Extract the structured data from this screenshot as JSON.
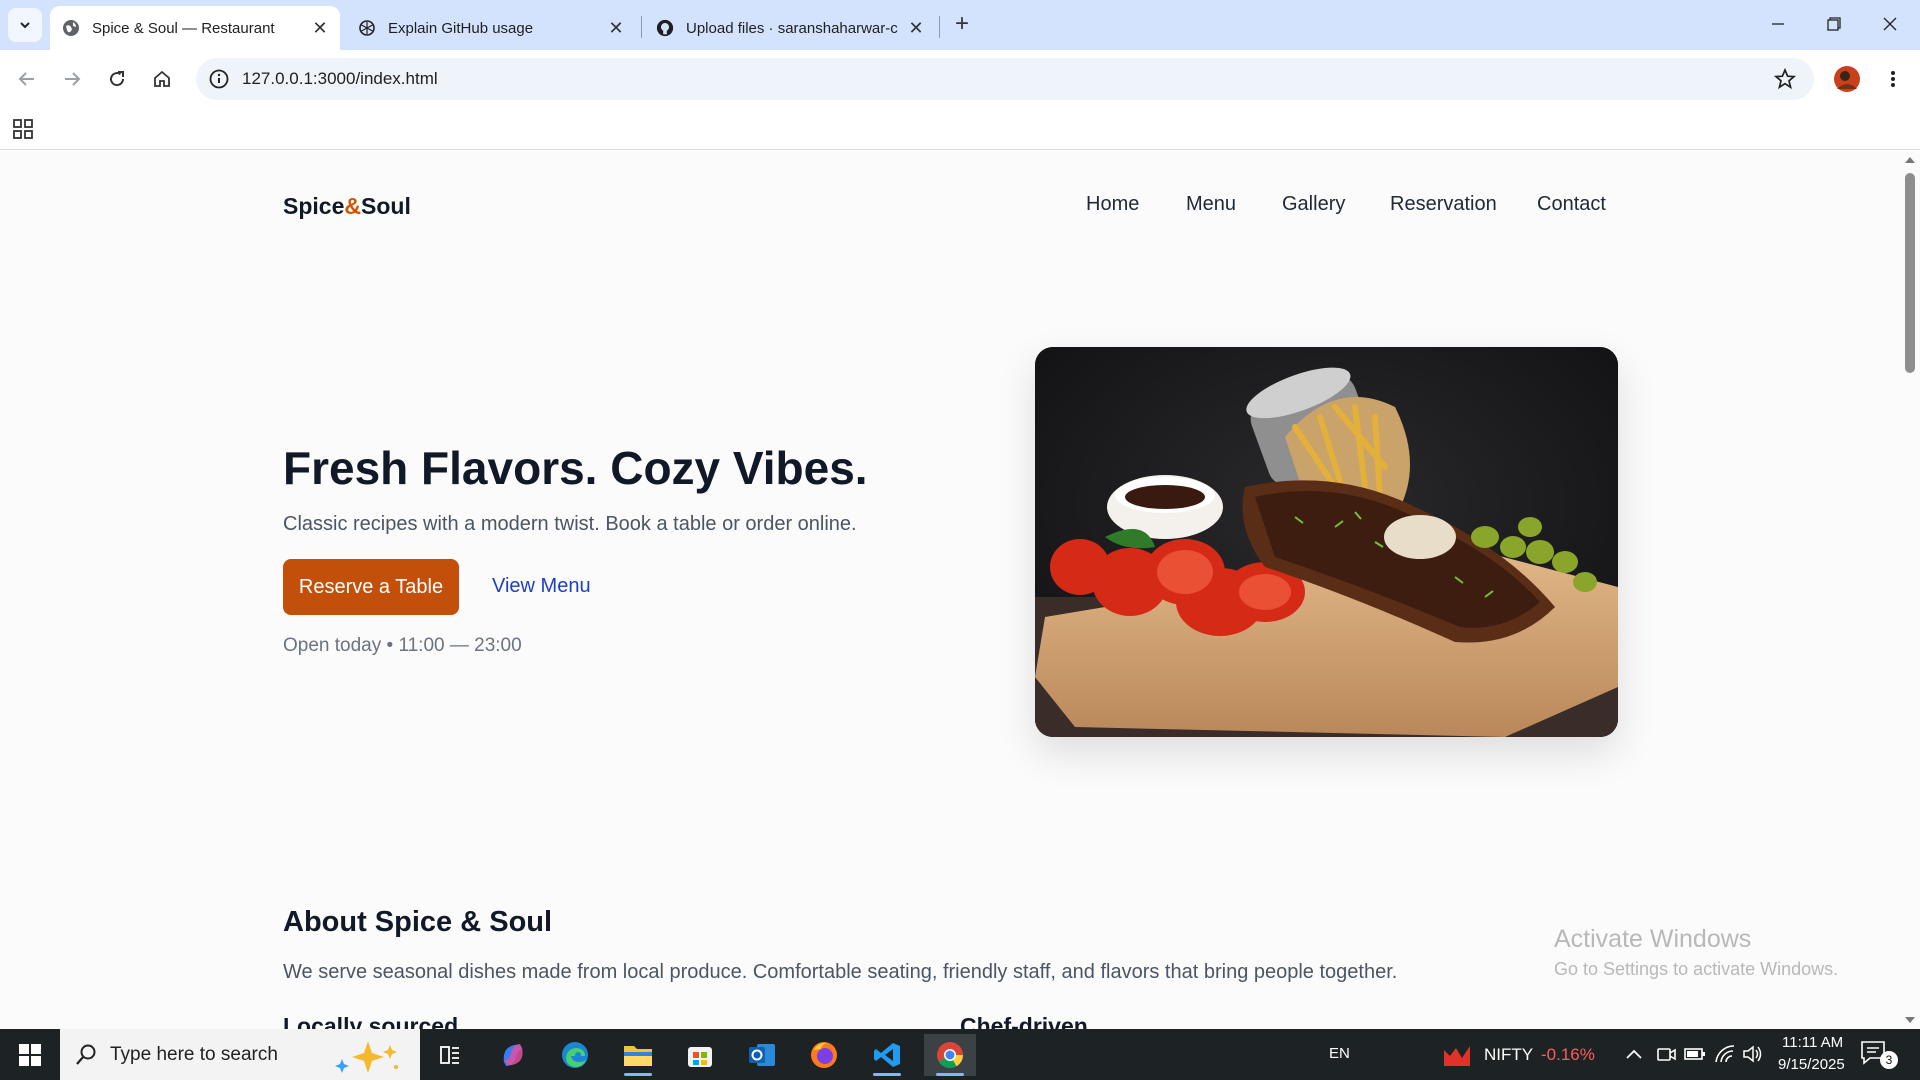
{
  "browser": {
    "tabs": [
      {
        "title": "Spice & Soul — Restaurant",
        "active": true
      },
      {
        "title": "Explain GitHub usage",
        "active": false
      },
      {
        "title": "Upload files · saranshaharwar-c",
        "active": false
      }
    ],
    "url": "127.0.0.1:3000/index.html"
  },
  "site": {
    "brand": {
      "part1": "Spice",
      "amp": "&",
      "part2": "Soul"
    },
    "nav": [
      "Home",
      "Menu",
      "Gallery",
      "Reservation",
      "Contact"
    ],
    "hero": {
      "title": "Fresh Flavors. Cozy Vibes.",
      "subtitle": "Classic recipes with a modern twist. Book a table or order online.",
      "primary_button": "Reserve a Table",
      "secondary_link": "View Menu",
      "hours": "Open today • 11:00 — 23:00"
    },
    "about": {
      "title": "About Spice & Soul",
      "text": "We serve seasonal dishes made from local produce. Comfortable seating, friendly staff, and flavors that bring people together.",
      "features": [
        "Locally sourced",
        "Chef-driven"
      ]
    }
  },
  "watermark": {
    "line1": "Activate Windows",
    "line2": "Go to Settings to activate Windows."
  },
  "taskbar": {
    "search_placeholder": "Type here to search",
    "language": "EN",
    "ticker_name": "NIFTY",
    "ticker_change": "-0.16%",
    "time": "11:11 AM",
    "date": "9/15/2025",
    "notifications": "3"
  },
  "colors": {
    "accent": "#c2500a",
    "link": "#1d3fc4",
    "ticker_down": "#ff5a5a"
  }
}
